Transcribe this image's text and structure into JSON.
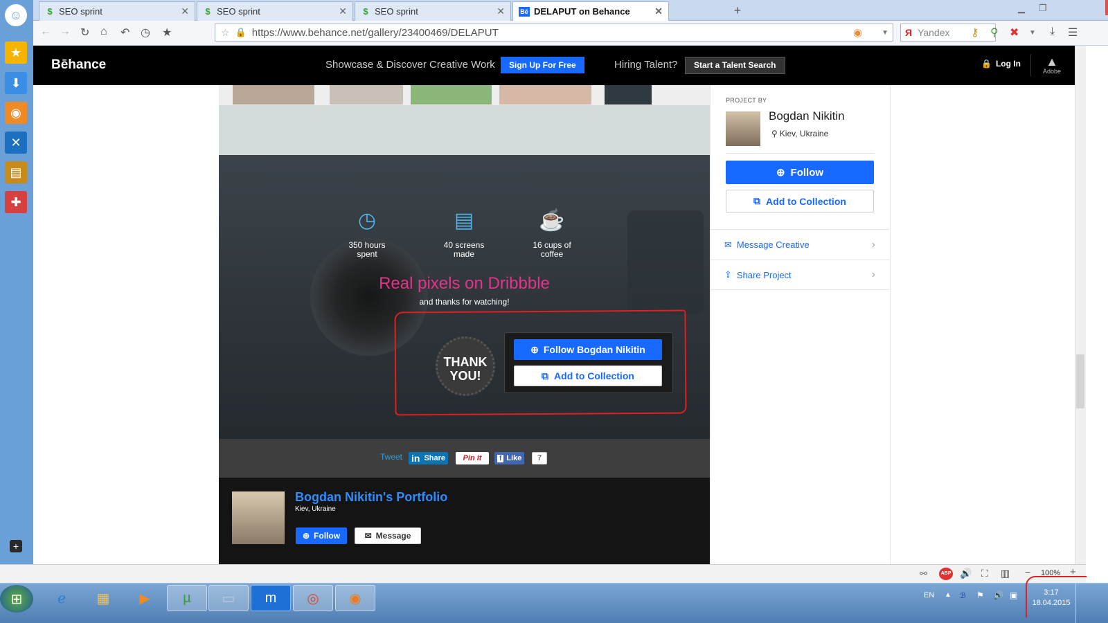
{
  "browser": {
    "tabs": [
      {
        "label": "SEO sprint"
      },
      {
        "label": "SEO sprint"
      },
      {
        "label": "SEO sprint"
      },
      {
        "label": "DELAPUT on Behance"
      }
    ],
    "url": "https://www.behance.net/gallery/23400469/DELAPUT",
    "search_engine": "Yandex",
    "zoom": "100%"
  },
  "header": {
    "logo": "Bēhance",
    "tagline": "Showcase & Discover Creative Work",
    "signup_label": "Sign Up For Free",
    "hiring": "Hiring Talent?",
    "talent_label": "Start a Talent Search",
    "login_label": "Log In",
    "adobe": "Adobe"
  },
  "project": {
    "stats": [
      {
        "line1": "350 hours",
        "line2": "spent"
      },
      {
        "line1": "40 screens",
        "line2": "made"
      },
      {
        "line1": "16 cups of",
        "line2": "coffee"
      }
    ],
    "headline": "Real pixels on Dribbble",
    "thanks": "and thanks for watching!",
    "badge_line1": "THANK",
    "badge_line2": "YOU!",
    "follow_label": "Follow Bogdan Nikitin",
    "collection_label": "Add to Collection"
  },
  "share": {
    "tweet": "Tweet",
    "linkedin": "Share",
    "pinit": "Pin it",
    "fb_like": "Like",
    "fb_count": "7"
  },
  "portfolio": {
    "name": "Bogdan Nikitin's Portfolio",
    "location": "Kiev, Ukraine",
    "follow_label": "Follow",
    "message_label": "Message"
  },
  "sidebar_right": {
    "project_by": "PROJECT BY",
    "name": "Bogdan Nikitin",
    "location": "Kiev, Ukraine",
    "follow_label": "Follow",
    "collection_label": "Add to Collection",
    "message_label": "Message Creative",
    "share_label": "Share Project"
  },
  "taskbar": {
    "lang": "EN",
    "time": "3:17",
    "date": "18.04.2015"
  },
  "colors": {
    "behance_blue": "#1769ff",
    "headline_pink": "#e4338a",
    "annotation_red": "#e02020"
  }
}
